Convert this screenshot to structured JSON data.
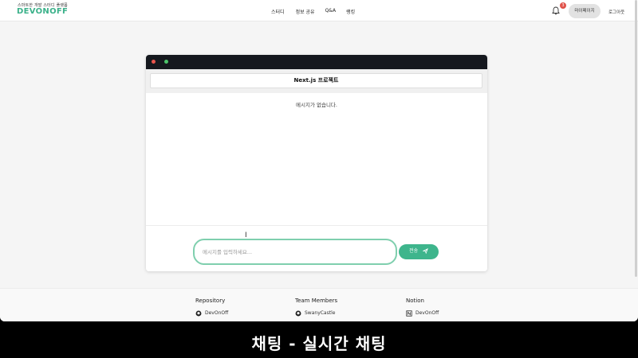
{
  "header": {
    "tagline": "스마트한 개발 스터디 플랫폼",
    "logo": "DEVONOFF",
    "nav": [
      "스터디",
      "정보 공유",
      "Q&A",
      "랭킹"
    ],
    "notification_count": "3",
    "mypage_label": "마이페이지",
    "logout_label": "로그아웃"
  },
  "chat": {
    "room_title": "Next.js 프로젝트",
    "empty_message": "메시지가 없습니다.",
    "input_placeholder": "메시지를 입력하세요...",
    "send_label": "전송"
  },
  "footer": {
    "columns": [
      {
        "heading": "Repository",
        "items": [
          "DevOnOff"
        ]
      },
      {
        "heading": "Team Members",
        "items": [
          "SwanyCastle"
        ]
      },
      {
        "heading": "Notion",
        "items": [
          "DevOnOff"
        ]
      }
    ]
  },
  "caption": "채팅 - 실시간 채팅",
  "colors": {
    "brand": "#3bb18a",
    "send_button": "#3eb58c",
    "input_border": "#7fcfae",
    "badge": "#e0524a",
    "titlebar": "#15181e"
  },
  "icons": {
    "notification": "bell-icon",
    "send": "paper-plane-icon",
    "repository": "github-icon",
    "team": "github-icon",
    "notion": "notion-icon"
  }
}
